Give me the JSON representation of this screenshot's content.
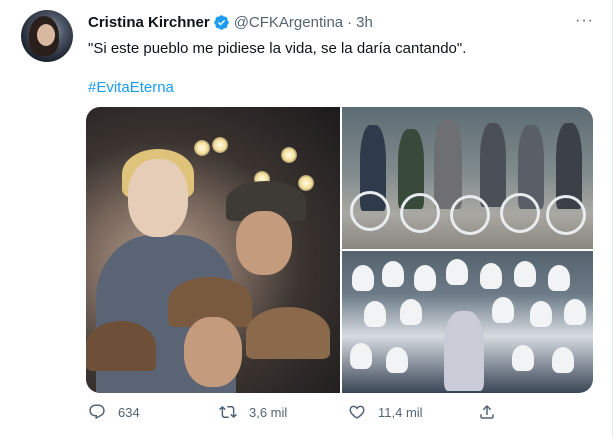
{
  "tweet": {
    "author_name": "Cristina Kirchner",
    "handle": "@CFKArgentina",
    "separator": "·",
    "time": "3h",
    "more_label": "···",
    "text": "\"Si este pueblo me pidiese la vida, se la daría cantando\".",
    "hashtag": "#EvitaEterna"
  },
  "actions": {
    "replies": "634",
    "retweets": "3,6 mil",
    "likes": "11,4 mil"
  },
  "icons": {
    "verified": "verified-badge-icon",
    "more": "more-options-icon",
    "reply": "reply-icon",
    "retweet": "retweet-icon",
    "like": "heart-icon",
    "share": "share-icon"
  },
  "colors": {
    "verified": "#1d9bf0",
    "hashtag": "#1d9bf0",
    "muted": "#536471"
  }
}
